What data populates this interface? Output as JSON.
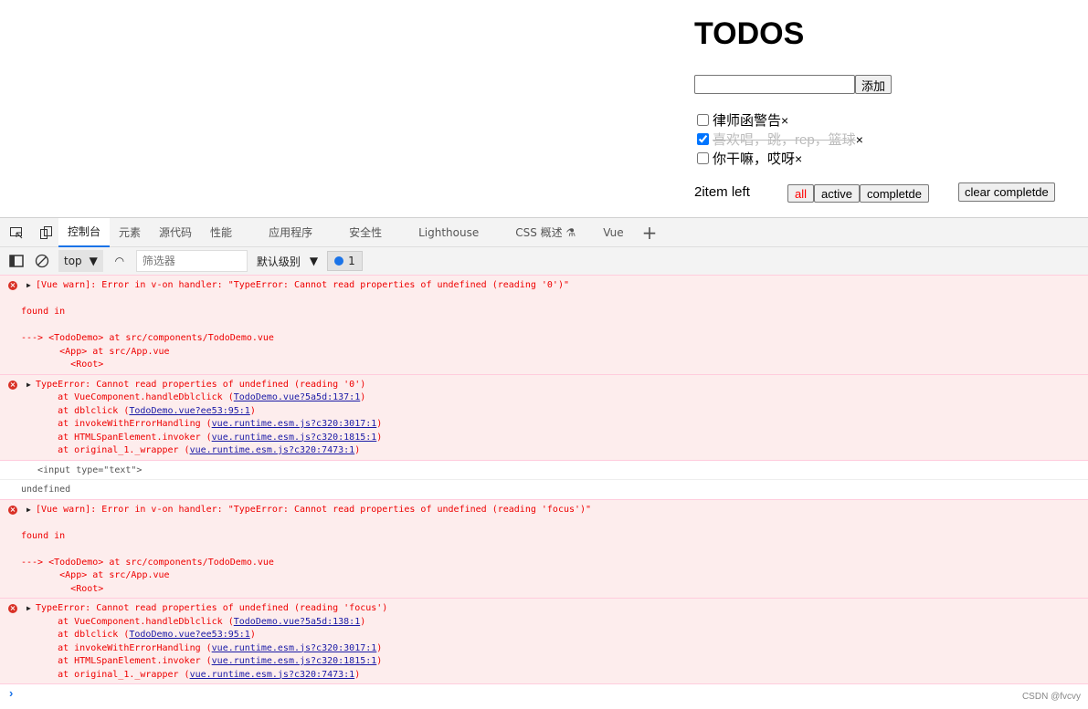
{
  "app": {
    "title": "TODOS",
    "input_value": "",
    "add_label": "添加",
    "items": [
      {
        "text": "律师函警告",
        "done": false
      },
      {
        "text": "喜欢唱，跳，rep，篮球",
        "done": true
      },
      {
        "text": "你干嘛，哎呀",
        "done": false
      }
    ],
    "delete_glyph": "×",
    "left_text": "2item left",
    "filters": [
      "all",
      "active",
      "completde"
    ],
    "active_filter": "all",
    "active_color": "#ff0000",
    "clear_label": "clear completde"
  },
  "devtools": {
    "tabs": [
      "控制台",
      "元素",
      "源代码",
      "性能",
      "应用程序",
      "安全性",
      "Lighthouse",
      "CSS 概述 ⚗",
      "Vue"
    ],
    "active_tab": "控制台",
    "context": "top",
    "filter_placeholder": "筛选器",
    "level": "默认级别",
    "issues_count": "1",
    "messages": [
      {
        "type": "error",
        "expandable": true,
        "lines": [
          "[Vue warn]: Error in v-on handler: \"TypeError: Cannot read properties of undefined (reading '0')\"",
          "",
          "found in",
          "",
          "---> <TodoDemo> at src/components/TodoDemo.vue",
          "       <App> at src/App.vue",
          "         <Root>"
        ]
      },
      {
        "type": "error",
        "expandable": true,
        "lines": [
          "TypeError: Cannot read properties of undefined (reading '0')"
        ],
        "frames": [
          {
            "fn": "    at VueComponent.handleDblclick (",
            "link": "TodoDemo.vue?5a5d:137:1"
          },
          {
            "fn": "    at dblclick (",
            "link": "TodoDemo.vue?ee53:95:1"
          },
          {
            "fn": "    at invokeWithErrorHandling (",
            "link": "vue.runtime.esm.js?c320:3017:1"
          },
          {
            "fn": "    at HTMLSpanElement.invoker (",
            "link": "vue.runtime.esm.js?c320:1815:1"
          },
          {
            "fn": "    at original_1._wrapper (",
            "link": "vue.runtime.esm.js?c320:7473:1"
          }
        ]
      },
      {
        "type": "log",
        "lines": [
          "   <input type=\"text\">"
        ]
      },
      {
        "type": "log",
        "lines": [
          "undefined"
        ]
      },
      {
        "type": "error",
        "expandable": true,
        "lines": [
          "[Vue warn]: Error in v-on handler: \"TypeError: Cannot read properties of undefined (reading 'focus')\"",
          "",
          "found in",
          "",
          "---> <TodoDemo> at src/components/TodoDemo.vue",
          "       <App> at src/App.vue",
          "         <Root>"
        ]
      },
      {
        "type": "error",
        "expandable": true,
        "lines": [
          "TypeError: Cannot read properties of undefined (reading 'focus')"
        ],
        "frames": [
          {
            "fn": "    at VueComponent.handleDblclick (",
            "link": "TodoDemo.vue?5a5d:138:1"
          },
          {
            "fn": "    at dblclick (",
            "link": "TodoDemo.vue?ee53:95:1"
          },
          {
            "fn": "    at invokeWithErrorHandling (",
            "link": "vue.runtime.esm.js?c320:3017:1"
          },
          {
            "fn": "    at HTMLSpanElement.invoker (",
            "link": "vue.runtime.esm.js?c320:1815:1"
          },
          {
            "fn": "    at original_1._wrapper (",
            "link": "vue.runtime.esm.js?c320:7473:1"
          }
        ]
      }
    ],
    "prompt_glyph": "›"
  },
  "watermark": "CSDN @fvcvy"
}
